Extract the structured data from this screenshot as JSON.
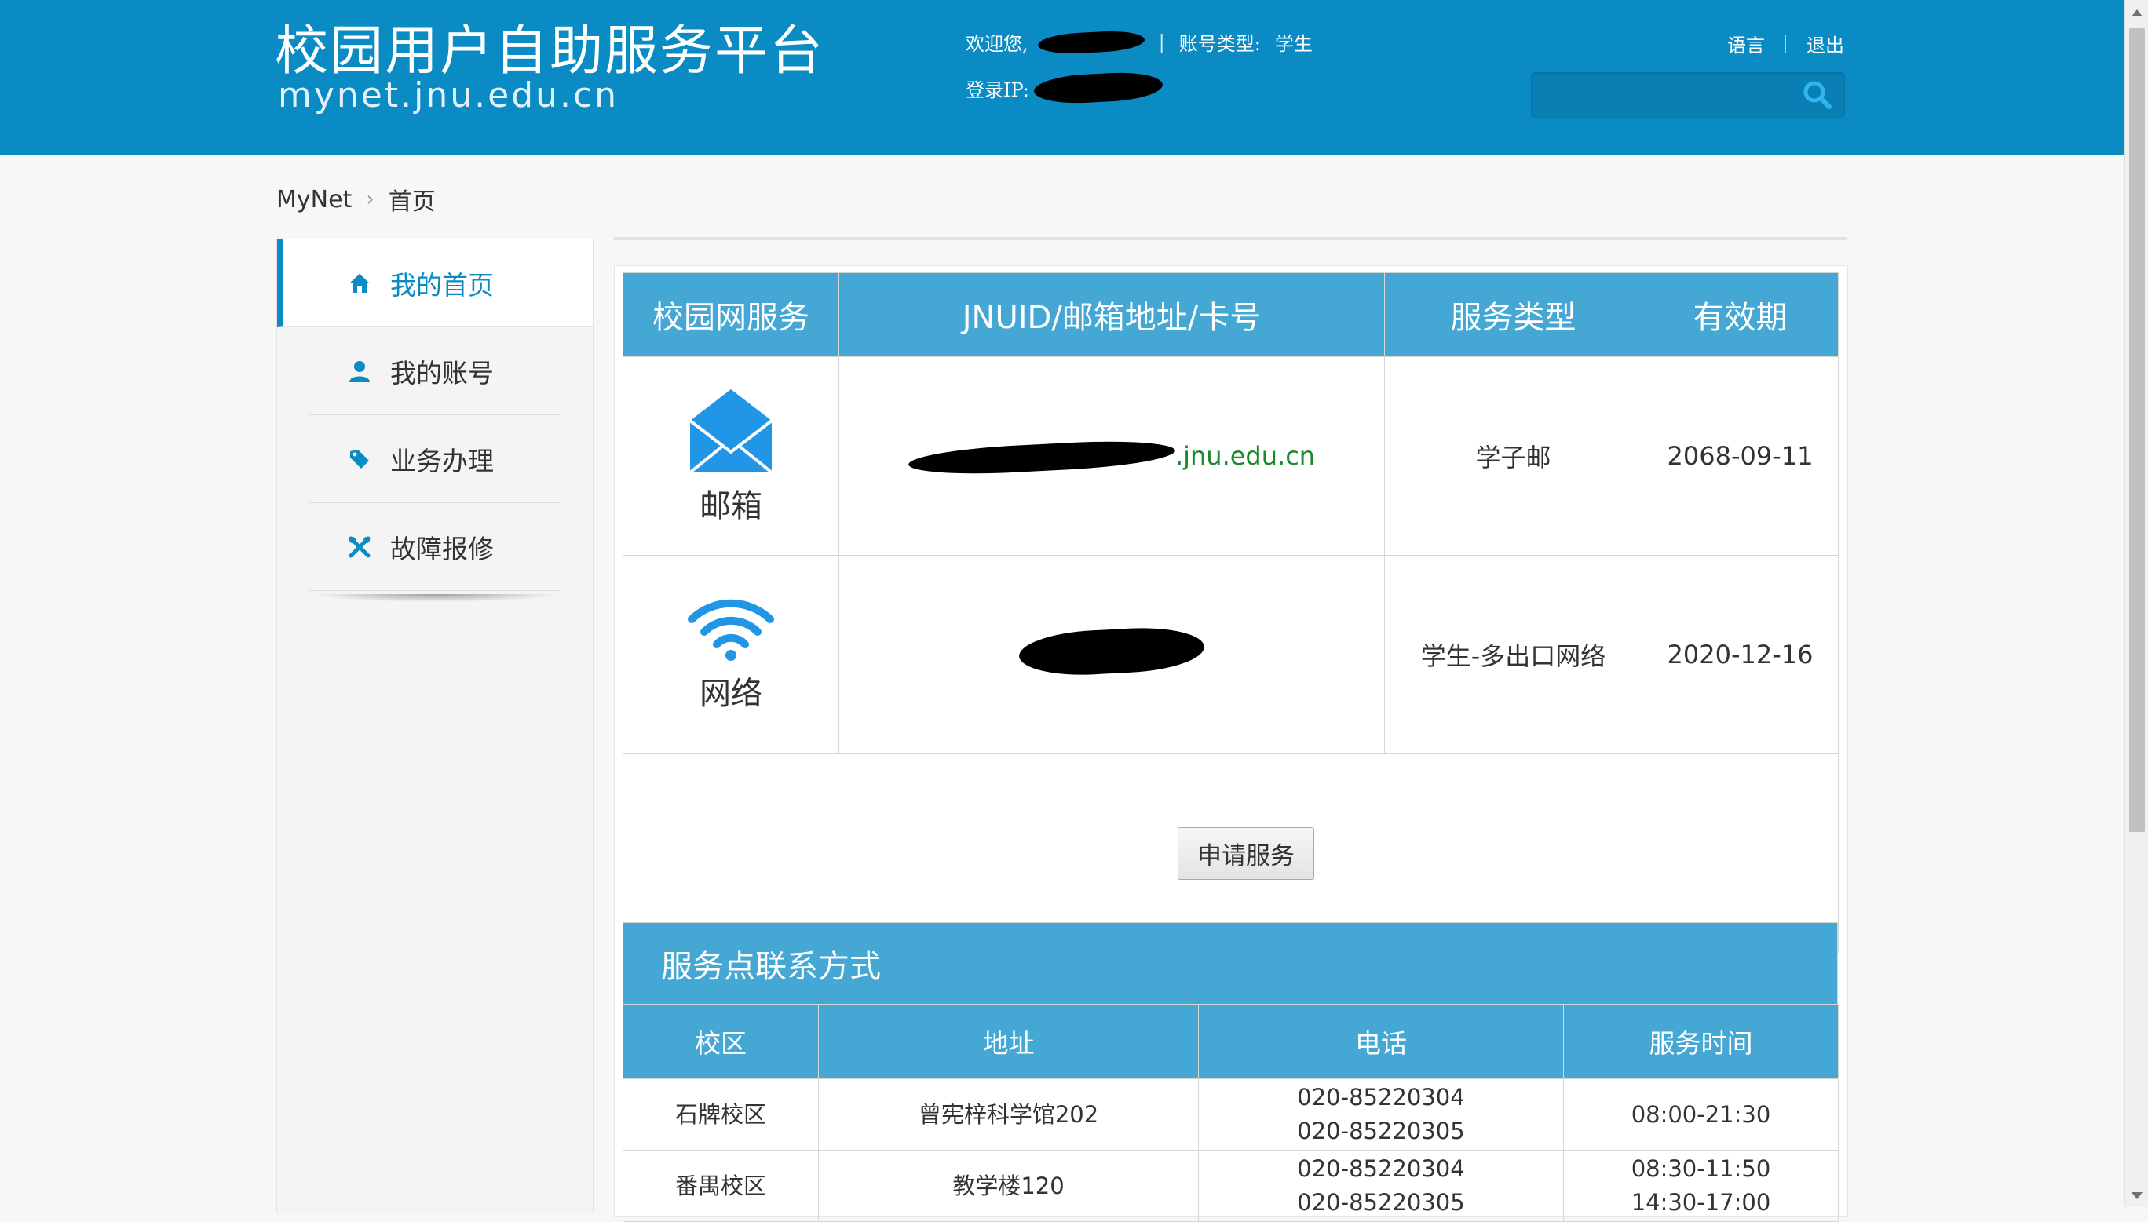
{
  "header": {
    "title": "校园用户自助服务平台",
    "subtitle": "mynet.jnu.edu.cn",
    "welcome_label": "欢迎您,",
    "account_type_label": "账号类型:",
    "account_type_value": "学生",
    "login_ip_label": "登录IP:",
    "language_link": "语言",
    "logout_link": "退出",
    "search_placeholder": ""
  },
  "breadcrumb": {
    "root": "MyNet",
    "current": "首页"
  },
  "sidebar": {
    "items": [
      {
        "label": "我的首页",
        "icon": "home-icon"
      },
      {
        "label": "我的账号",
        "icon": "user-icon"
      },
      {
        "label": "业务办理",
        "icon": "tag-icon"
      },
      {
        "label": "故障报修",
        "icon": "tools-icon"
      }
    ]
  },
  "services_table": {
    "headers": [
      "校园网服务",
      "JNUID/邮箱地址/卡号",
      "服务类型",
      "有效期"
    ],
    "rows": [
      {
        "service": "邮箱",
        "icon": "envelope-icon",
        "id_suffix": ".jnu.edu.cn",
        "type": "学子邮",
        "expiry": "2068-09-11"
      },
      {
        "service": "网络",
        "icon": "wifi-icon",
        "id_suffix": "",
        "type": "学生-多出口网络",
        "expiry": "2020-12-16"
      }
    ],
    "apply_button": "申请服务"
  },
  "contact": {
    "title": "服务点联系方式",
    "headers": [
      "校区",
      "地址",
      "电话",
      "服务时间"
    ],
    "rows": [
      {
        "campus": "石牌校区",
        "address": "曾宪梓科学馆202",
        "phone1": "020-85220304",
        "phone2": "020-85220305",
        "time1": "08:00-21:30",
        "time2": ""
      },
      {
        "campus": "番禺校区",
        "address": "教学楼120",
        "phone1": "020-85220304",
        "phone2": "020-85220305",
        "time1": "08:30-11:50",
        "time2": "14:30-17:00"
      }
    ]
  },
  "colors": {
    "header_bg": "#0a8bc4",
    "table_header_bg": "#45a7d4",
    "accent": "#0a8bc4",
    "email_green": "#1a8a2c"
  }
}
